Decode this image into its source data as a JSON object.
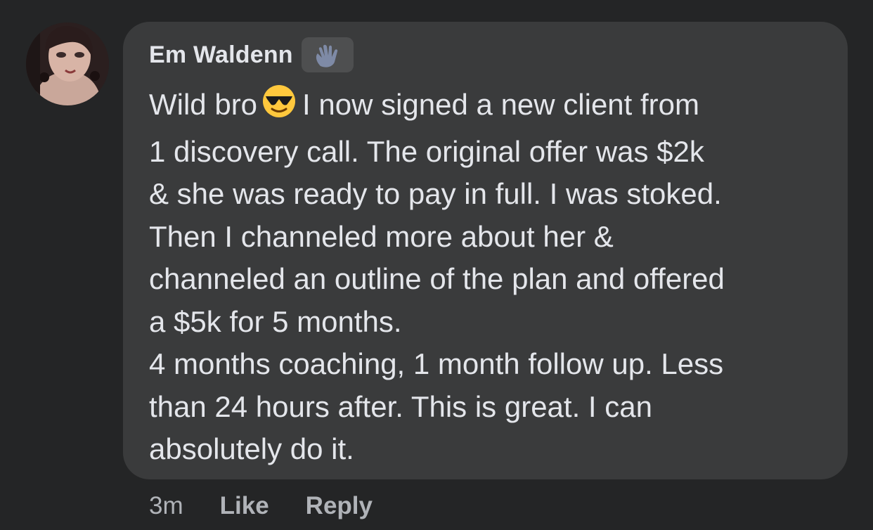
{
  "comment": {
    "author": "Em Waldenn",
    "badge_icon": "waving-hand-icon",
    "text_before_emoji": "Wild bro",
    "emoji": "smiling-face-with-sunglasses-icon",
    "text_after_emoji": "I now signed a new client from",
    "body_lines": [
      "1 discovery call. The original offer was $2k",
      "& she was ready to pay in full. I was stoked.",
      "Then I channeled more about her &",
      "channeled an outline of the plan and offered",
      "a $5k for 5 months.",
      "4 months coaching, 1 month follow up. Less",
      "than 24 hours after. This is great. I can",
      "absolutely do it."
    ]
  },
  "actions": {
    "time": "3m",
    "like_label": "Like",
    "reply_label": "Reply"
  },
  "colors": {
    "background": "#242526",
    "bubble": "#3a3b3c",
    "text": "#e4e6eb",
    "secondary_text": "#b0b3b8"
  }
}
